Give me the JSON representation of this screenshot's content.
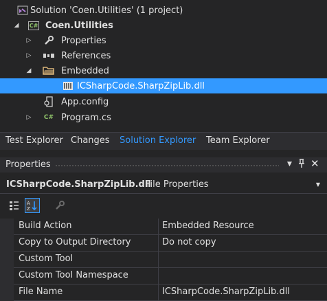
{
  "solution_explorer": {
    "solution_label": "Solution 'Coen.Utilities' (1 project)",
    "project_label": "Coen.Utilities",
    "items": {
      "properties": "Properties",
      "references": "References",
      "embedded": "Embedded",
      "dll": "ICSharpCode.SharpZipLib.dll",
      "appconfig": "App.config",
      "programcs": "Program.cs"
    },
    "project_icon_text": "C#",
    "programcs_icon_text": "C#"
  },
  "tabs": [
    "Test Explorer",
    "Changes",
    "Solution Explorer",
    "Team Explorer"
  ],
  "active_tab": "Solution Explorer",
  "properties_panel": {
    "title": "Properties",
    "pin_glyph": "2",
    "object_name": "ICSharpCode.SharpZipLib.dll",
    "object_type": "File Properties",
    "rows": [
      {
        "name": "Build Action",
        "value": "Embedded Resource"
      },
      {
        "name": "Copy to Output Directory",
        "value": "Do not copy"
      },
      {
        "name": "Custom Tool",
        "value": ""
      },
      {
        "name": "Custom Tool Namespace",
        "value": ""
      },
      {
        "name": "File Name",
        "value": "ICSharpCode.SharpZipLib.dll"
      }
    ]
  },
  "colors": {
    "background": "#252526",
    "selection": "#3399ff",
    "active_tab_text": "#3399ff",
    "text": "#e0e0e0"
  }
}
